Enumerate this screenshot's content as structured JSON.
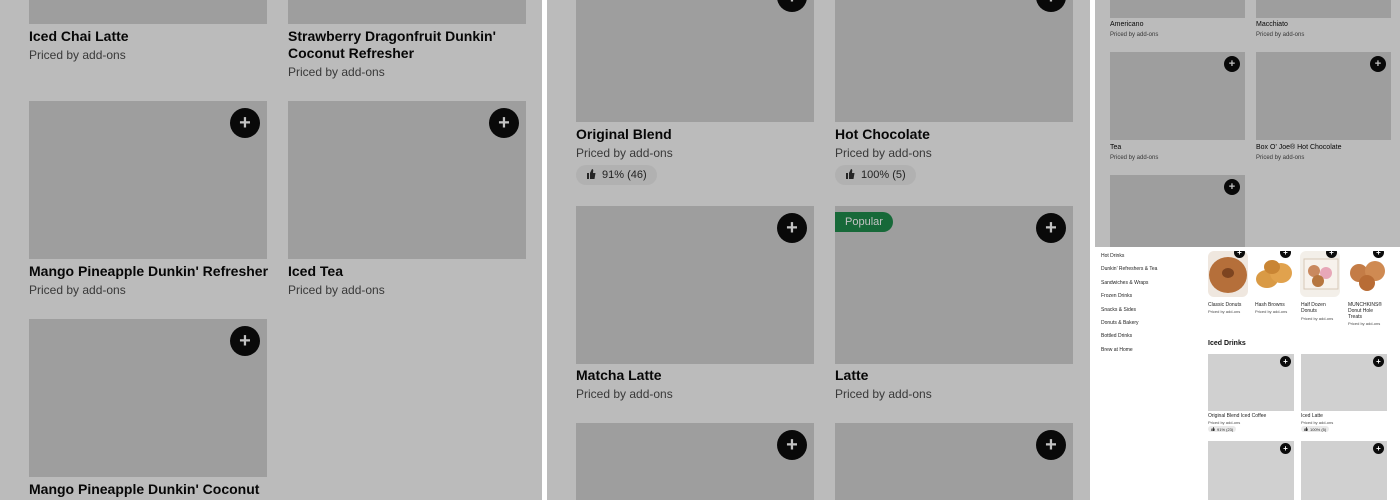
{
  "add_symbol": "+",
  "colors": {
    "card_image": "#d0d0d0",
    "add_button": "#0c0c0c",
    "popular_badge": "#1f8a4c",
    "dim_overlay": "rgba(0,0,0,0.24)"
  },
  "icons": {
    "add": "plus-icon",
    "rating": "thumbs-up-icon"
  },
  "panel1": {
    "items": [
      {
        "name": "Iced Chai Latte",
        "price": "Priced by add-ons"
      },
      {
        "name_line1": "Strawberry Dragonfruit Dunkin'",
        "name_line2": "Coconut Refresher",
        "price": "Priced by add-ons"
      },
      {
        "name": "Mango Pineapple Dunkin' Refresher",
        "price": "Priced by add-ons"
      },
      {
        "name": "Iced Tea",
        "price": "Priced by add-ons"
      },
      {
        "name": "Mango Pineapple Dunkin' Coconut",
        "price": ""
      }
    ]
  },
  "panel2": {
    "items": [
      {
        "name": "Original Blend",
        "price": "Priced by add-ons",
        "rating": "91% (46)"
      },
      {
        "name": "Hot Chocolate",
        "price": "Priced by add-ons",
        "rating": "100% (5)"
      },
      {
        "name": "Matcha Latte",
        "price": "Priced by add-ons"
      },
      {
        "name": "Latte",
        "price": "Priced by add-ons",
        "badge": "Popular"
      }
    ]
  },
  "panel3": {
    "items": [
      {
        "name": "Americano",
        "price": "Priced by add-ons"
      },
      {
        "name": "Macchiato",
        "price": "Priced by add-ons"
      },
      {
        "name": "Tea",
        "price": "Priced by add-ons"
      },
      {
        "name": "Box O' Joe® Hot Chocolate",
        "price": "Priced by add-ons"
      }
    ]
  },
  "panel4": {
    "categories": [
      "Hot Drinks",
      "Dunkin' Refreshers & Tea",
      "Sandwiches & Wraps",
      "Frozen Drinks",
      "Snacks & Sides",
      "Donuts & Bakery",
      "Bottled Drinks",
      "Brew at Home"
    ],
    "top_items": [
      {
        "name": "Classic Donuts",
        "price": "Priced by add-ons"
      },
      {
        "name": "Hash Browns",
        "price": "Priced by add-ons"
      },
      {
        "name": "Half Dozen Donuts",
        "price": "Priced by add-ons"
      },
      {
        "name": "MUNCHKINS® Donut Hole Treats",
        "price": "Priced by add-ons"
      }
    ],
    "section_title": "Iced Drinks",
    "iced_items": [
      {
        "name": "Original Blend Iced Coffee",
        "price": "Priced by add-ons",
        "rating": "91% (23)"
      },
      {
        "name": "Iced Latte",
        "price": "Priced by add-ons",
        "rating": "100% (5)"
      }
    ]
  }
}
